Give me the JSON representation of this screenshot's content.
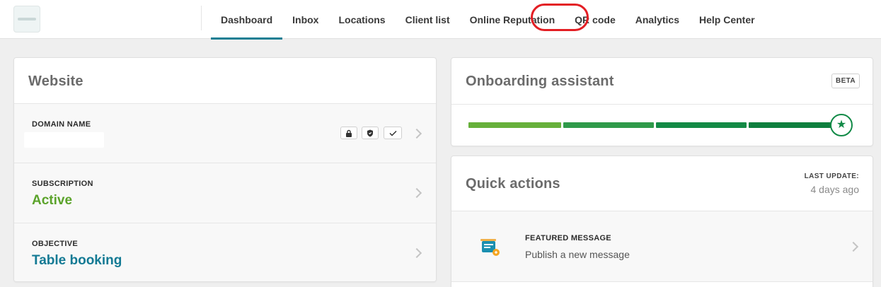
{
  "nav": {
    "items": [
      {
        "label": "Dashboard",
        "active": true
      },
      {
        "label": "Inbox"
      },
      {
        "label": "Locations"
      },
      {
        "label": "Client list"
      },
      {
        "label": "Online Reputation"
      },
      {
        "label": "QR code",
        "highlighted": true
      },
      {
        "label": "Analytics"
      },
      {
        "label": "Help Center"
      }
    ]
  },
  "website": {
    "title": "Website",
    "domain_label": "DOMAIN NAME",
    "domain_icons": [
      "lock-icon",
      "shield-icon",
      "check-icon"
    ],
    "subscription_label": "SUBSCRIPTION",
    "subscription_value": "Active",
    "objective_label": "OBJECTIVE",
    "objective_value": "Table booking"
  },
  "onboarding": {
    "title": "Onboarding assistant",
    "badge": "BETA",
    "progress_segments_completed": 4,
    "progress_segments_total": 4,
    "segment_colors": [
      "#66b03a",
      "#2f9a4a",
      "#138a45",
      "#0e7f3e"
    ]
  },
  "quick_actions": {
    "title": "Quick actions",
    "last_update_label": "LAST UPDATE:",
    "last_update_value": "4 days ago",
    "items": [
      {
        "label": "FEATURED MESSAGE",
        "description": "Publish a new message",
        "icon": "featured-message-icon"
      }
    ]
  },
  "colors": {
    "accent": "#1a7f93",
    "active_green": "#5ba32b",
    "objective_teal": "#137a94",
    "highlight_red": "#e31e24"
  }
}
